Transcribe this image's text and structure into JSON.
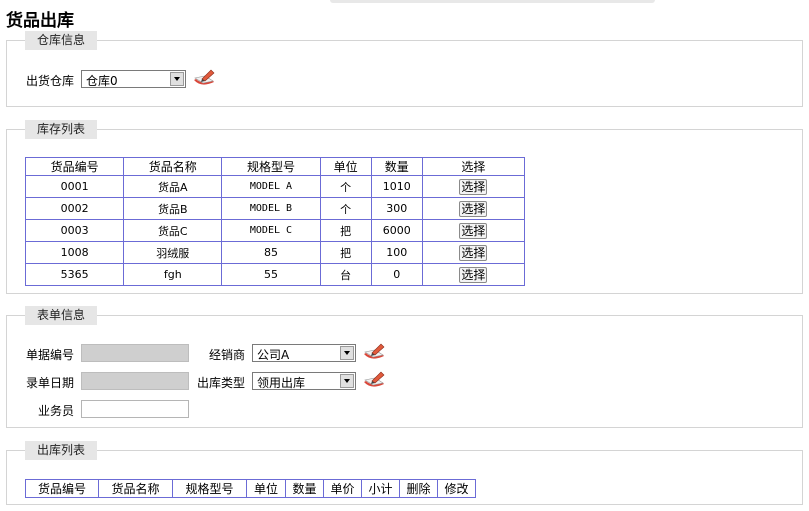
{
  "page": {
    "title": "货品出库"
  },
  "warehouse_panel": {
    "legend": "仓库信息",
    "label": "出货仓库",
    "selected": "仓库0"
  },
  "stock_panel": {
    "legend": "库存列表",
    "columns": [
      "货品编号",
      "货品名称",
      "规格型号",
      "单位",
      "数量",
      "选择"
    ],
    "rows": [
      {
        "code": "0001",
        "name": "货品A",
        "spec": "MODEL A",
        "unit": "个",
        "qty": "1010",
        "action": "选择"
      },
      {
        "code": "0002",
        "name": "货品B",
        "spec": "MODEL B",
        "unit": "个",
        "qty": "300",
        "action": "选择"
      },
      {
        "code": "0003",
        "name": "货品C",
        "spec": "MODEL C",
        "unit": "把",
        "qty": "6000",
        "action": "选择"
      },
      {
        "code": "1008",
        "name": "羽绒服",
        "spec": "85",
        "unit": "把",
        "qty": "100",
        "action": "选择"
      },
      {
        "code": "5365",
        "name": "fgh",
        "spec": "55",
        "unit": "台",
        "qty": "0",
        "action": "选择"
      }
    ]
  },
  "form_panel": {
    "legend": "表单信息",
    "doc_no_label": "单据编号",
    "doc_no_value": "",
    "date_label": "录单日期",
    "date_value": "",
    "dealer_label": "经销商",
    "dealer_selected": "公司A",
    "type_label": "出库类型",
    "type_selected": "领用出库",
    "staff_label": "业务员",
    "staff_value": ""
  },
  "outbound_panel": {
    "legend": "出库列表",
    "columns": [
      "货品编号",
      "货品名称",
      "规格型号",
      "单位",
      "数量",
      "单价",
      "小计",
      "删除",
      "修改"
    ]
  },
  "icons": {
    "edit": "edit-pen-icon",
    "dropdown": "chevron-down-icon"
  },
  "colors": {
    "grid_border": "#6b6bd6",
    "legend_bg": "#e6e6e6",
    "disabled_input": "#cfcfcf"
  }
}
